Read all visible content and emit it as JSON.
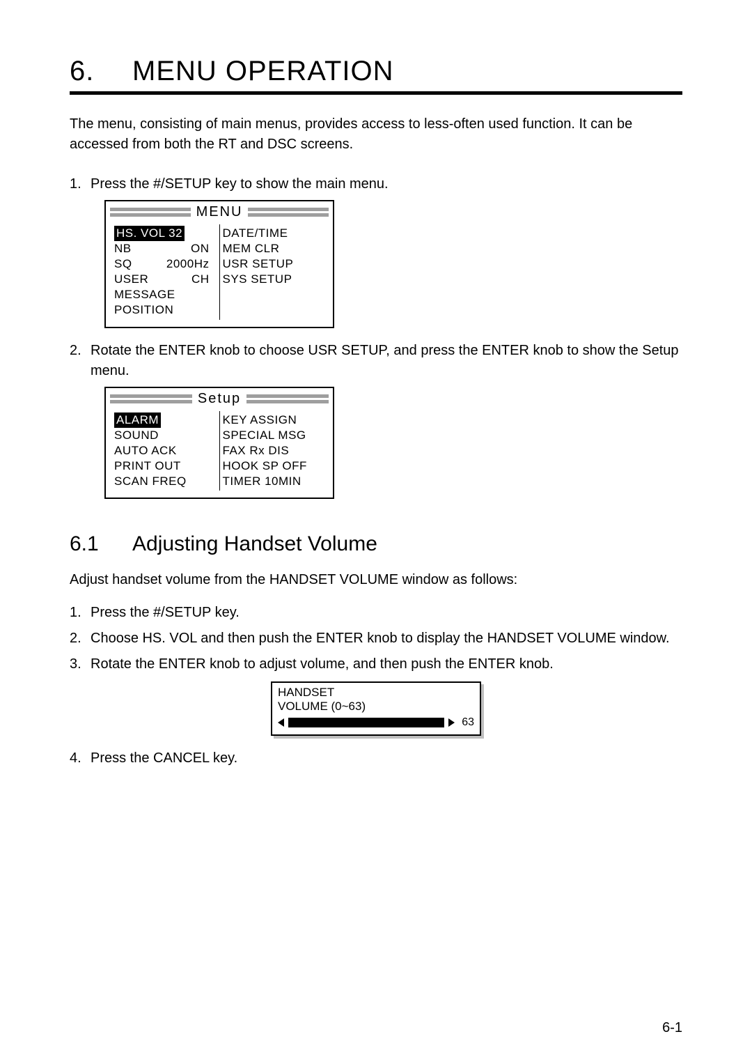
{
  "chapter": {
    "num": "6.",
    "title": "MENU OPERATION"
  },
  "intro": "The menu, consisting of main menus, provides access to less-often used function. It can be accessed from both the RT and DSC screens.",
  "steps_a": {
    "s1": {
      "n": "1.",
      "t": "Press the #/SETUP key to show the main menu."
    },
    "s2": {
      "n": "2.",
      "t": "Rotate the ENTER knob to choose USR SETUP, and press the ENTER knob to show the Setup menu."
    }
  },
  "menu": {
    "title": "MENU",
    "left": {
      "sel": "HS. VOL 32",
      "nb_l": "NB",
      "nb_v": "ON",
      "sq_l": "SQ",
      "sq_v": "2000Hz",
      "user_l": "USER",
      "user_v": "CH",
      "msg": "MESSAGE",
      "pos": "POSITION"
    },
    "right": {
      "r1": "DATE/TIME",
      "r2": "MEM CLR",
      "r3": "USR SETUP",
      "r4": "SYS SETUP"
    }
  },
  "setup": {
    "title": "Setup",
    "left": {
      "sel": "ALARM",
      "l2": "SOUND",
      "l3": "AUTO ACK",
      "l4": "PRINT OUT",
      "l5": "SCAN FREQ"
    },
    "right": {
      "r1": "KEY ASSIGN",
      "r2": "SPECIAL MSG",
      "r3": "FAX Rx DIS",
      "r4": "HOOK SP OFF",
      "r5": "TIMER 10MIN"
    }
  },
  "section": {
    "num": "6.1",
    "title": "Adjusting Handset Volume"
  },
  "sec_intro": "Adjust handset volume from the HANDSET VOLUME window as follows:",
  "steps_b": {
    "s1": {
      "n": "1.",
      "t": "Press the #/SETUP key."
    },
    "s2": {
      "n": "2.",
      "t": "Choose HS. VOL and then push the ENTER knob to display the HANDSET VOLUME window."
    },
    "s3": {
      "n": "3.",
      "t": "Rotate the ENTER knob to adjust volume, and then push the ENTER knob."
    },
    "s4": {
      "n": "4.",
      "t": "Press the CANCEL key."
    }
  },
  "vol": {
    "l1": "HANDSET",
    "l2": "VOLUME (0~63)",
    "value": "63"
  },
  "page_num": "6-1"
}
